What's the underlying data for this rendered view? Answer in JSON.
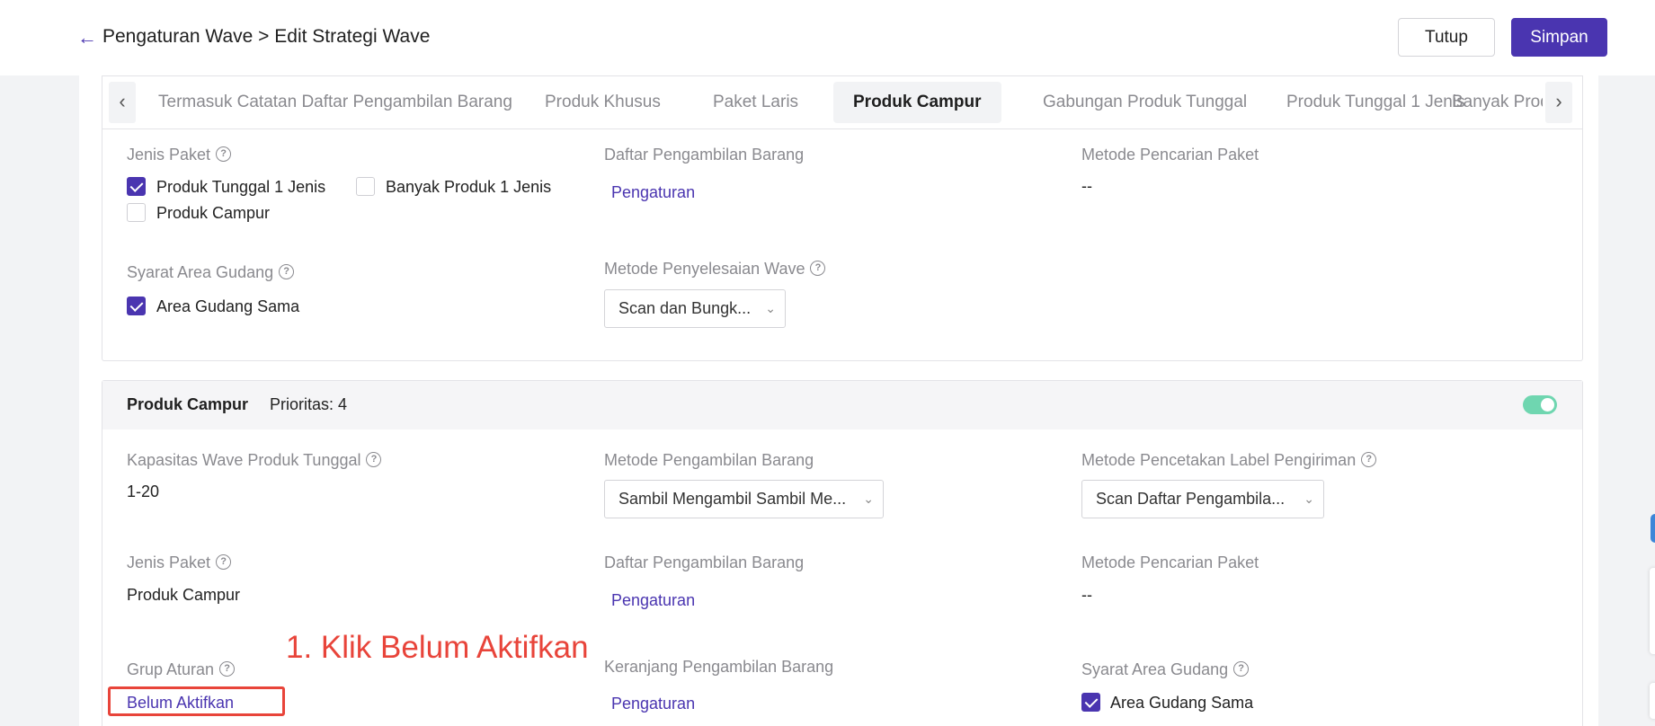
{
  "header": {
    "title": "Pengaturan Wave > Edit Strategi Wave",
    "close_label": "Tutup",
    "save_label": "Simpan"
  },
  "tabs": {
    "items": [
      {
        "label": "Termasuk Catatan Daftar Pengambilan Barang",
        "active": false
      },
      {
        "label": "Produk Khusus",
        "active": false
      },
      {
        "label": "Paket Laris",
        "active": false
      },
      {
        "label": "Produk Campur",
        "active": true
      },
      {
        "label": "Gabungan Produk Tunggal",
        "active": false
      },
      {
        "label": "Produk Tunggal 1 Jenis",
        "active": false
      },
      {
        "label": "Banyak Produk",
        "active": false
      }
    ]
  },
  "card1": {
    "jenis_paket_label": "Jenis Paket",
    "opt_produk_tunggal": "Produk Tunggal 1 Jenis",
    "opt_banyak_produk": "Banyak Produk 1 Jenis",
    "opt_produk_campur": "Produk Campur",
    "daftar_label": "Daftar Pengambilan Barang",
    "daftar_link": "Pengaturan",
    "metode_pencarian_label": "Metode Pencarian Paket",
    "metode_pencarian_value": "--",
    "syarat_area_label": "Syarat Area Gudang",
    "area_sama_label": "Area Gudang Sama",
    "metode_penyelesaian_label": "Metode Penyelesaian Wave",
    "metode_penyelesaian_value": "Scan dan Bungk..."
  },
  "card2": {
    "title": "Produk Campur",
    "priority": "Prioritas: 4",
    "kapasitas_label": "Kapasitas Wave Produk Tunggal",
    "kapasitas_value": "1-20",
    "metode_pengambilan_label": "Metode Pengambilan Barang",
    "metode_pengambilan_value": "Sambil Mengambil Sambil Me...",
    "metode_pencetakan_label": "Metode Pencetakan Label Pengiriman",
    "metode_pencetakan_value": "Scan Daftar Pengambila...",
    "jenis_paket_label": "Jenis Paket",
    "jenis_paket_value": "Produk Campur",
    "daftar_label": "Daftar Pengambilan Barang",
    "daftar_link": "Pengaturan",
    "metode_pencarian_label": "Metode Pencarian Paket",
    "metode_pencarian_value": "--",
    "grup_aturan_label": "Grup Aturan",
    "grup_aturan_link": "Belum Aktifkan",
    "keranjang_label": "Keranjang Pengambilan Barang",
    "keranjang_link": "Pengaturan",
    "syarat_area_label": "Syarat Area Gudang",
    "area_sama_label": "Area Gudang Sama"
  },
  "annotation": {
    "text": "1. Klik Belum Aktifkan"
  },
  "colors": {
    "accent": "#4a35b0",
    "toggle_on": "#6fd6b0",
    "annotation": "#e8443a"
  }
}
